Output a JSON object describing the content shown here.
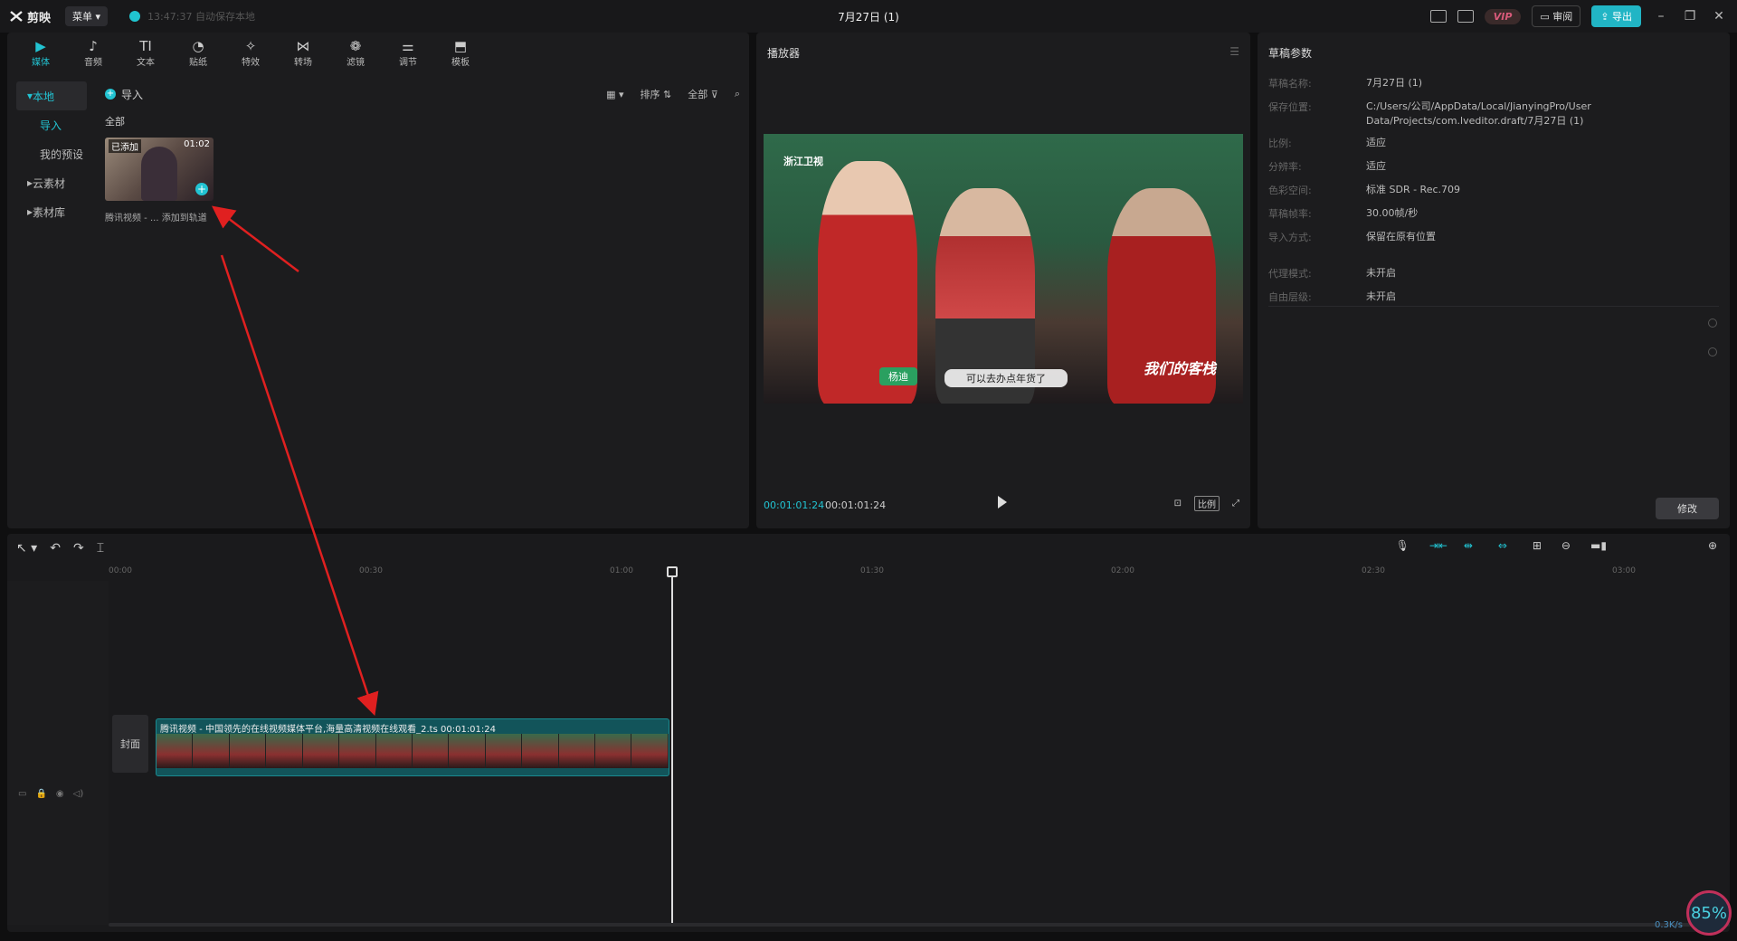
{
  "app": {
    "logo_text": "剪映",
    "menu_label": "菜单",
    "autosave_text": "13:47:37 自动保存本地",
    "doc_title": "7月27日 (1)",
    "vip_label": "VIP",
    "review_label": "审阅",
    "export_label": "导出"
  },
  "tools": [
    {
      "label": "媒体",
      "icon": "media-icon",
      "glyph": "▶"
    },
    {
      "label": "音频",
      "icon": "audio-icon",
      "glyph": "♪"
    },
    {
      "label": "文本",
      "icon": "text-icon",
      "glyph": "TI"
    },
    {
      "label": "贴纸",
      "icon": "sticker-icon",
      "glyph": "◔"
    },
    {
      "label": "特效",
      "icon": "effects-icon",
      "glyph": "✧"
    },
    {
      "label": "转场",
      "icon": "transition-icon",
      "glyph": "⋈"
    },
    {
      "label": "滤镜",
      "icon": "filter-icon",
      "glyph": "❁"
    },
    {
      "label": "调节",
      "icon": "adjust-icon",
      "glyph": "⚌"
    },
    {
      "label": "模板",
      "icon": "template-icon",
      "glyph": "⬒"
    }
  ],
  "nav": {
    "local": "本地",
    "import": "导入",
    "presets": "我的预设",
    "cloud": "云素材",
    "library": "素材库"
  },
  "media": {
    "import_label": "导入",
    "sort_label": "排序",
    "filter_label": "全部",
    "all_label": "全部",
    "thumb_added": "已添加",
    "thumb_duration": "01:02",
    "thumb_caption": "腾讯视频 - ...",
    "thumb_add_tip": "添加到轨道"
  },
  "player": {
    "title": "播放器",
    "current_time": "00:01:01:24",
    "total_time": "00:01:01:24",
    "ratio_label": "比例",
    "video_channel": "浙江卫视",
    "video_name": "杨迪",
    "video_subtitle": "可以去办点年货了",
    "video_brand": "我们的客栈"
  },
  "props": {
    "title": "草稿参数",
    "rows": [
      {
        "label": "草稿名称:",
        "value": "7月27日 (1)"
      },
      {
        "label": "保存位置:",
        "value": "C:/Users/公司/AppData/Local/JianyingPro/User Data/Projects/com.lveditor.draft/7月27日 (1)"
      },
      {
        "label": "比例:",
        "value": "适应"
      },
      {
        "label": "分辨率:",
        "value": "适应"
      },
      {
        "label": "色彩空间:",
        "value": "标准 SDR - Rec.709"
      },
      {
        "label": "草稿帧率:",
        "value": "30.00帧/秒"
      },
      {
        "label": "导入方式:",
        "value": "保留在原有位置"
      },
      {
        "label": "代理模式:",
        "value": "未开启"
      },
      {
        "label": "自由层级:",
        "value": "未开启"
      }
    ],
    "modify_label": "修改"
  },
  "timeline": {
    "ticks": [
      "00:00",
      "00:30",
      "01:00",
      "01:30",
      "02:00",
      "02:30",
      "03:00"
    ],
    "cover_label": "封面",
    "clip_label": "腾讯视频 - 中国领先的在线视频媒体平台,海量高清视频在线观看_2.ts   00:01:01:24"
  },
  "watermark": {
    "percent": "85",
    "speed": "0.3K/s"
  }
}
